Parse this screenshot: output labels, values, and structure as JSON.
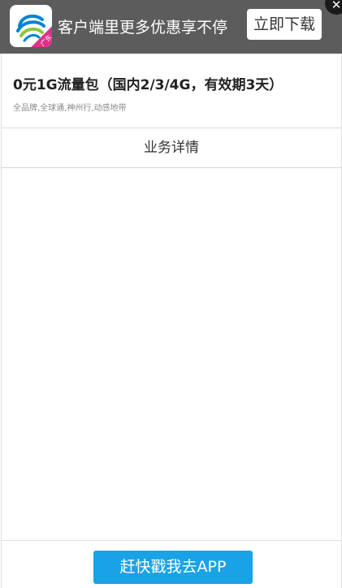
{
  "banner": {
    "text": "客户端里更多优惠享不停",
    "download_label": "立即下载",
    "close_symbol": "✕",
    "app_icon": "china-mobile-logo-icon",
    "region_badge": "广东",
    "bg_color": "#5c5c5c"
  },
  "product": {
    "title": "0元1G流量包（国内2/3/4G，有效期3天）",
    "tags": "全品牌,全球通,神州行,动感地带"
  },
  "tabs": {
    "detail_label": "业务详情"
  },
  "footer": {
    "cta_label": "赶快戳我去APP",
    "cta_color": "#1aa2e6"
  }
}
